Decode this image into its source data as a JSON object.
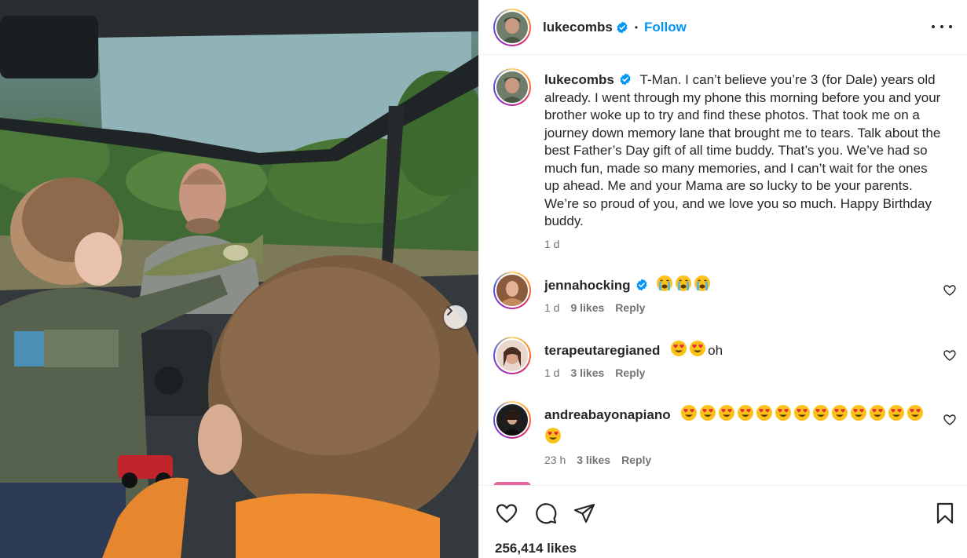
{
  "post": {
    "username": "lukecombs",
    "follow_label": "Follow",
    "separator": "•",
    "more_icon": "more-horizontal-icon",
    "photo_alt": "Father holding a fish out to two young boys from inside a vehicle by a lake",
    "next_icon": "chevron-right-icon"
  },
  "caption": {
    "username": "lukecombs",
    "text": "T-Man. I can’t believe you’re 3 (for Dale) years old already. I went through my phone this morning before you and your brother woke up to try and find these photos. That took me on a journey down memory lane that brought me to tears. Talk about the best Father’s Day gift of all time buddy. That’s you. We’ve had so much fun, made so many memories, and I can’t wait for the ones up ahead. Me and your Mama are so lucky to be your parents. We’re so proud of you, and we love you so much. Happy Birthday buddy.",
    "time": "1 d"
  },
  "comments": [
    {
      "username": "jennahocking",
      "verified": true,
      "emojis": [
        "crying-face",
        "crying-face",
        "crying-face"
      ],
      "text": "",
      "time": "1 d",
      "likes": "9 likes",
      "reply": "Reply"
    },
    {
      "username": "terapeutaregianed",
      "verified": false,
      "emojis": [
        "heart-eyes",
        "heart-eyes"
      ],
      "text": "oh",
      "time": "1 d",
      "likes": "3 likes",
      "reply": "Reply"
    },
    {
      "username": "andreabayonapiano",
      "verified": false,
      "emojis": [
        "heart-eyes",
        "heart-eyes",
        "heart-eyes",
        "heart-eyes",
        "heart-eyes",
        "heart-eyes",
        "heart-eyes",
        "heart-eyes",
        "heart-eyes",
        "heart-eyes",
        "heart-eyes",
        "heart-eyes",
        "heart-eyes",
        "heart-eyes"
      ],
      "text": "",
      "time": "23 h",
      "likes": "3 likes",
      "reply": "Reply"
    }
  ],
  "footer": {
    "likes": "256,414 likes",
    "icons": [
      "heart-icon",
      "comment-icon",
      "share-icon",
      "bookmark-icon"
    ]
  },
  "colors": {
    "link": "#0095f6",
    "text": "#262626",
    "muted": "#737373",
    "verified": "#0095f6"
  }
}
